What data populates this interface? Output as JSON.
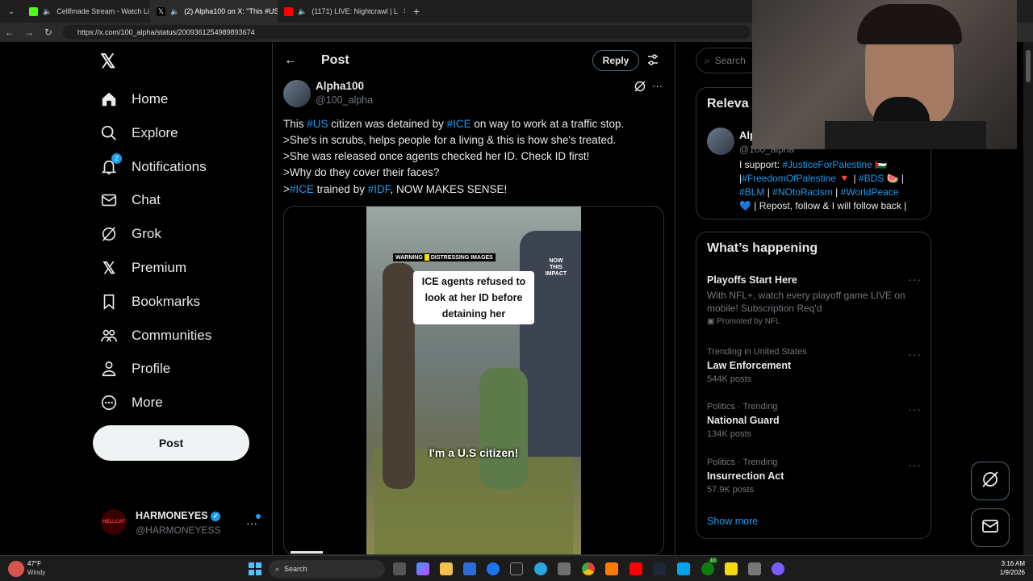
{
  "browser": {
    "tabs": [
      {
        "title": "Cellfmade Stream - Watch Li",
        "color": "#53fc18"
      },
      {
        "title": "(2) Alpha100 on X: \"This #US",
        "color": "#ffffff"
      },
      {
        "title": "(1171) LIVE: Nightcrawl | L",
        "color": "#ff0000"
      }
    ],
    "url": "https://x.com/100_alpha/status/2009361254989893674",
    "new_tab": "+"
  },
  "nav": {
    "items": [
      {
        "label": "Home",
        "icon": "home-icon"
      },
      {
        "label": "Explore",
        "icon": "search-icon"
      },
      {
        "label": "Notifications",
        "icon": "bell-icon",
        "badge": "2"
      },
      {
        "label": "Chat",
        "icon": "mail-icon"
      },
      {
        "label": "Grok",
        "icon": "grok-icon"
      },
      {
        "label": "Premium",
        "icon": "x-icon"
      },
      {
        "label": "Bookmarks",
        "icon": "bookmark-icon"
      },
      {
        "label": "Communities",
        "icon": "people-icon"
      },
      {
        "label": "Profile",
        "icon": "person-icon"
      },
      {
        "label": "More",
        "icon": "more-circle-icon"
      }
    ],
    "post_label": "Post",
    "account": {
      "name": "HARMONEYES",
      "handle": "@HARMONEYESS",
      "avatar_text": "HELLCAT"
    }
  },
  "post_header": {
    "title": "Post",
    "reply_label": "Reply"
  },
  "tweet": {
    "author": "Alpha100",
    "handle": "@100_alpha",
    "line1": {
      "pre": "This ",
      "tag1": "#US",
      "mid": " citizen was detained by ",
      "tag2": "#ICE",
      "post": " on way to work at a traffic stop."
    },
    "line2": ">She's in scrubs, helps people for a living & this is how she's treated.",
    "line3": ">She was released once agents checked her ID. Check ID first!",
    "line4": ">Why do they cover their faces?",
    "line5": {
      "pre": ">",
      "tag1": "#ICE",
      "mid": " trained by ",
      "tag2": "#IDF",
      "post": ", NOW MAKES SENSE!"
    }
  },
  "video": {
    "warning": "WARNING",
    "warning_sub": "DISTRESSING IMAGES",
    "caption": "ICE agents refused to look at her ID before detaining her",
    "subtitle": "I'm a U.S citizen!",
    "watermark": "NOW THIS IMPACT"
  },
  "sidebar": {
    "search_placeholder": "Search",
    "relevant_title": "Releva",
    "relevant_user_name": "Alp",
    "relevant_user_handle": "@100_alpha",
    "bio_line1": {
      "pre": "I support: ",
      "tag": "#JusticeForPalestine",
      "post": " 🇵🇸"
    },
    "bio_line2": {
      "pre": "|",
      "tag1": "#FreedomOfPalestine",
      "mid1": " 🔻 | ",
      "tag2": "#BDS",
      "post": " 🍉 |"
    },
    "bio_line3": {
      "tag1": "#BLM",
      "sep1": " | ",
      "tag2": "#NOtoRacism",
      "sep2": " | ",
      "tag3": "#WorldPeace"
    },
    "bio_line4": "💙 | Repost, follow & I will follow back |",
    "happening_title": "What’s happening",
    "trends": [
      {
        "meta": "",
        "title": "Playoffs Start Here",
        "sub": "With NFL+, watch every playoff game LIVE on mobile! Subscription Req'd",
        "promo": "Promoted by NFL"
      },
      {
        "meta": "Trending in United States",
        "title": "Law Enforcement",
        "sub": "544K posts"
      },
      {
        "meta": "Politics · Trending",
        "title": "National Guard",
        "sub": "134K posts"
      },
      {
        "meta": "Politics · Trending",
        "title": "Insurrection Act",
        "sub": "57.9K posts"
      }
    ],
    "show_more": "Show more"
  },
  "taskbar": {
    "weather_temp": "47°F",
    "weather_desc": "Windy",
    "search": "Search",
    "time": "3:16 AM",
    "date": "1/9/2026",
    "badge_green": "10"
  },
  "colors": {
    "accent": "#1d9bf0",
    "bg": "#000000",
    "border": "#2f3336",
    "muted": "#71767b"
  }
}
